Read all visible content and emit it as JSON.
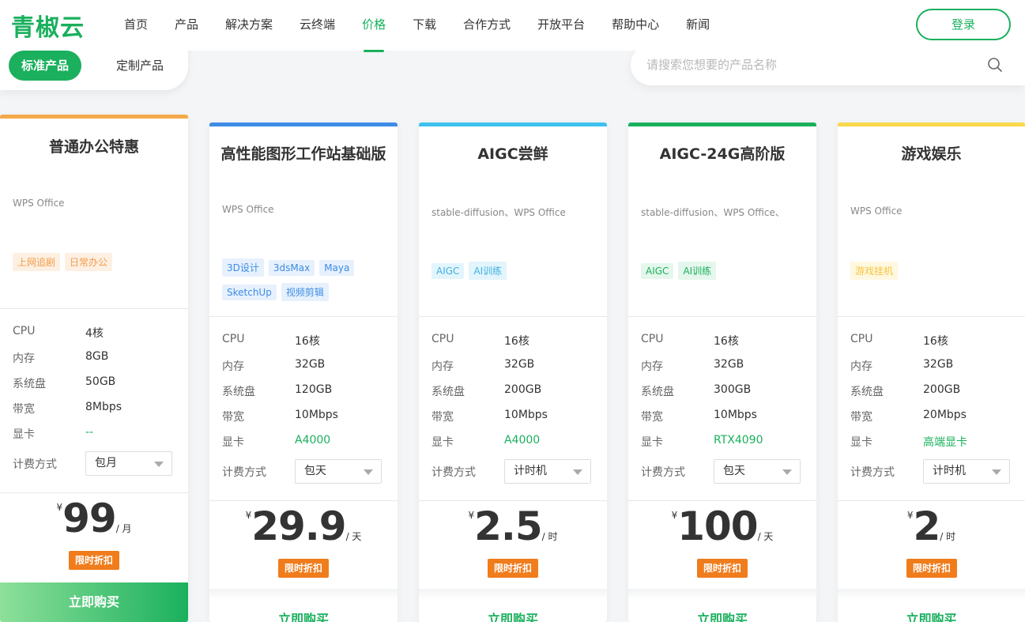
{
  "brand": {
    "name": "青椒云",
    "color": "#1ab05d"
  },
  "nav": {
    "items": [
      "首页",
      "产品",
      "解决方案",
      "云终端",
      "价格",
      "下载",
      "合作方式",
      "开放平台",
      "帮助中心",
      "新闻"
    ],
    "active": "价格",
    "login": "登录"
  },
  "product_tabs": [
    "标准产品",
    "定制产品"
  ],
  "search": {
    "placeholder": "请搜索您想要的产品名称",
    "icon": "search-icon"
  },
  "labels": {
    "cpu": "CPU",
    "mem": "内存",
    "disk": "系统盘",
    "bw": "带宽",
    "gpu": "显卡",
    "billing": "计费方式",
    "discount": "限时折扣",
    "buy": "立即购买",
    "currency": "¥"
  },
  "cards": [
    {
      "accent": "#f5a94a",
      "title": "普通办公特惠",
      "desc": "WPS Office",
      "tags": [
        "上网追剧",
        "日常办公"
      ],
      "cpu": "4核",
      "mem": "8GB",
      "disk": "50GB",
      "bw": "8Mbps",
      "gpu": "--",
      "billing": "包月",
      "price": "99",
      "unit": "/ 月"
    },
    {
      "accent": "#3d8ce6",
      "title": "高性能图形工作站基础版",
      "desc": "WPS Office",
      "tags": [
        "3D设计",
        "3dsMax",
        "Maya",
        "SketchUp",
        "视频剪辑"
      ],
      "cpu": "16核",
      "mem": "32GB",
      "disk": "120GB",
      "bw": "10Mbps",
      "gpu": "A4000",
      "billing": "包天",
      "price": "29.9",
      "unit": "/ 天"
    },
    {
      "accent": "#3fc1ef",
      "title": "AIGC尝鲜",
      "desc": "stable-diffusion、WPS Office",
      "tags": [
        "AIGC",
        "AI训练"
      ],
      "cpu": "16核",
      "mem": "32GB",
      "disk": "200GB",
      "bw": "10Mbps",
      "gpu": "A4000",
      "billing": "计时机",
      "price": "2.5",
      "unit": "/ 时"
    },
    {
      "accent": "#1ab05d",
      "title": "AIGC-24G高阶版",
      "desc": "stable-diffusion、WPS Office、",
      "tags": [
        "AIGC",
        "AI训练"
      ],
      "cpu": "16核",
      "mem": "32GB",
      "disk": "300GB",
      "bw": "10Mbps",
      "gpu": "RTX4090",
      "billing": "包天",
      "price": "100",
      "unit": "/ 天"
    },
    {
      "accent": "#f9d84a",
      "title": "游戏娱乐",
      "desc": "WPS Office",
      "tags": [
        "游戏挂机"
      ],
      "cpu": "16核",
      "mem": "32GB",
      "disk": "200GB",
      "bw": "20Mbps",
      "gpu": "高端显卡",
      "billing": "计时机",
      "price": "2",
      "unit": "/ 时"
    }
  ]
}
